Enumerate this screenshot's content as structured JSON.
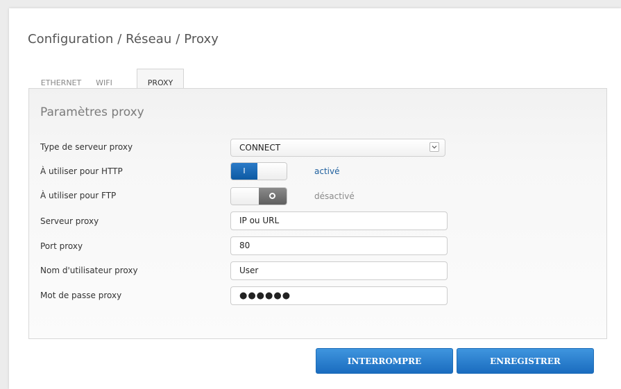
{
  "breadcrumb": "Configuration / Réseau / Proxy",
  "tabs": [
    {
      "label": "ETHERNET",
      "active": false
    },
    {
      "label": "WIFI",
      "active": false
    },
    {
      "label": "PROXY",
      "active": true
    }
  ],
  "panel": {
    "title": "Paramètres proxy",
    "proxy_type": {
      "label": "Type de serveur proxy",
      "value": "CONNECT"
    },
    "use_http": {
      "label": "À utiliser pour HTTP",
      "toggle_text": "I",
      "state": "activé",
      "enabled": true
    },
    "use_ftp": {
      "label": "À utiliser pour FTP",
      "state": "désactivé",
      "enabled": false
    },
    "server": {
      "label": "Serveur proxy",
      "value": "IP ou URL"
    },
    "port": {
      "label": "Port proxy",
      "value": "80"
    },
    "user": {
      "label": "Nom d'utilisateur proxy",
      "value": "User"
    },
    "password": {
      "label": "Mot de passe proxy",
      "value": "●●●●●●"
    }
  },
  "buttons": {
    "cancel": "INTERROMPRE",
    "save": "ENREGISTRER"
  },
  "colors": {
    "accent": "#1a6cbf",
    "toggle_on": "#0d5aa3",
    "toggle_off": "#5f5f5f",
    "status_on": "#1e5f9e"
  }
}
